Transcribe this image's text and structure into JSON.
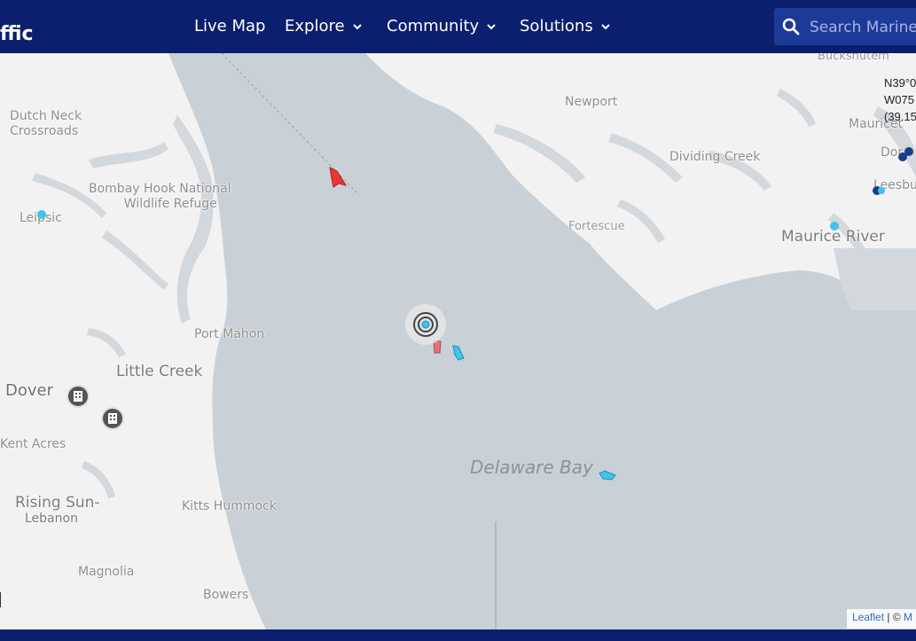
{
  "header": {
    "logo_text": "ffic",
    "nav": [
      {
        "label": "Live Map",
        "has_dropdown": false
      },
      {
        "label": "Explore",
        "has_dropdown": true
      },
      {
        "label": "Community",
        "has_dropdown": true
      },
      {
        "label": "Solutions",
        "has_dropdown": true
      }
    ],
    "search_placeholder": "Search MarineTraffic"
  },
  "coordinates": {
    "lat": "N39°0",
    "lon": "W075",
    "decimal": "(39.15"
  },
  "places": {
    "dutch_neck_1": "Dutch Neck",
    "dutch_neck_2": "Crossroads",
    "bombay_1": "Bombay Hook National",
    "bombay_2": "Wildlife Refuge",
    "leipsic": "Leipsic",
    "port_mahon": "Port Mahon",
    "little_creek": "Little Creek",
    "dover": "Dover",
    "kent_acres": "Kent Acres",
    "rising_sun_1": "Rising Sun-",
    "rising_sun_2": "Lebanon",
    "kitts_hummock": "Kitts Hummock",
    "magnolia": "Magnolia",
    "bowers": "Bowers",
    "newport": "Newport",
    "dividing_creek": "Dividing Creek",
    "fortescue": "Fortescue",
    "maurice_river": "Maurice River",
    "buckshutem": "Buckshutem",
    "mauricetown": "Mauricet",
    "dorchester": "Dor",
    "leesburg": "Leesbur",
    "delaware_bay": "Delaware Bay"
  },
  "attribution": {
    "leaflet": "Leaflet",
    "sep": " | © ",
    "tail": "M"
  },
  "colors": {
    "header_bg": "#0b1f6e",
    "water": "#c9d1d6",
    "land": "#f2f2f2",
    "ship_red": "#e53935",
    "ship_cyan": "#40c4e8",
    "ship_blue": "#1e3a8a"
  }
}
